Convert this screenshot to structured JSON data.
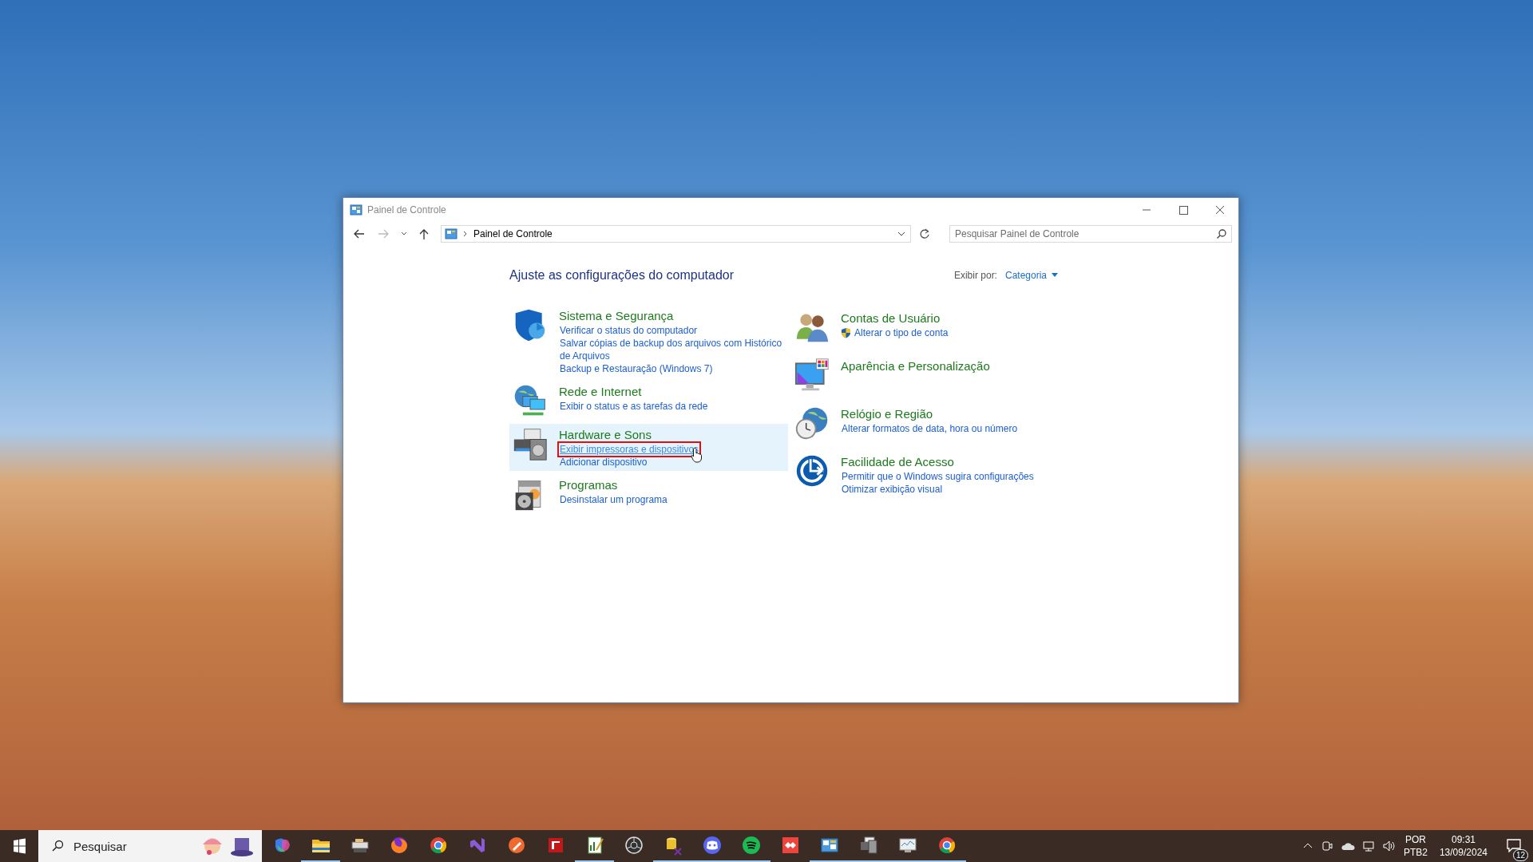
{
  "window": {
    "title": "Painel de Controle"
  },
  "address_bar": {
    "back": {
      "disabled": false
    },
    "forward": {
      "disabled": true
    },
    "path": "Painel de Controle",
    "search": {
      "placeholder": "Pesquisar Painel de Controle"
    }
  },
  "heading": "Ajuste as configurações do computador",
  "view_by": {
    "label": "Exibir por:",
    "value": "Categoria"
  },
  "categories_left": [
    {
      "kind": "shield",
      "title": "Sistema e Segurança",
      "highlighted": false,
      "links": [
        {
          "text": "Verificar o status do computador",
          "hovered": false,
          "marked": false,
          "shield": false
        },
        {
          "text": "Salvar cópias de backup dos arquivos com Histórico de Arquivos",
          "hovered": false,
          "marked": false,
          "shield": false
        },
        {
          "text": "Backup e Restauração (Windows 7)",
          "hovered": false,
          "marked": false,
          "shield": false
        }
      ]
    },
    {
      "kind": "network",
      "title": "Rede e Internet",
      "highlighted": false,
      "links": [
        {
          "text": "Exibir o status e as tarefas da rede",
          "hovered": false,
          "marked": false,
          "shield": false
        }
      ]
    },
    {
      "kind": "printer",
      "title": "Hardware e Sons",
      "highlighted": true,
      "links": [
        {
          "text": "Exibir impressoras e dispositivos",
          "hovered": true,
          "marked": true,
          "shield": false
        },
        {
          "text": "Adicionar dispositivo",
          "hovered": false,
          "marked": false,
          "shield": false
        }
      ]
    },
    {
      "kind": "programs",
      "title": "Programas",
      "highlighted": false,
      "links": [
        {
          "text": "Desinstalar um programa",
          "hovered": false,
          "marked": false,
          "shield": false
        }
      ]
    }
  ],
  "categories_right": [
    {
      "kind": "users",
      "title": "Contas de Usuário",
      "highlighted": false,
      "links": [
        {
          "text": "Alterar o tipo de conta",
          "hovered": false,
          "marked": false,
          "shield": true
        }
      ]
    },
    {
      "kind": "monitor",
      "title": "Aparência e Personalização",
      "highlighted": false
    },
    {
      "kind": "clock",
      "title": "Relógio e Região",
      "highlighted": false,
      "links": [
        {
          "text": "Alterar formatos de data, hora ou número",
          "hovered": false,
          "marked": false,
          "shield": false
        }
      ]
    },
    {
      "kind": "access",
      "title": "Facilidade de Acesso",
      "highlighted": false,
      "links": [
        {
          "text": "Permitir que o Windows sugira configurações",
          "hovered": false,
          "marked": false,
          "shield": false
        },
        {
          "text": "Otimizar exibição visual",
          "hovered": false,
          "marked": false,
          "shield": false
        }
      ]
    }
  ],
  "taskbar": {
    "search": {
      "placeholder": "Pesquisar"
    },
    "apps": [
      {
        "kind": "swirl",
        "running": false
      },
      {
        "kind": "folder",
        "running": true
      },
      {
        "kind": "scanner",
        "running": false
      },
      {
        "kind": "foxglobe",
        "running": false
      },
      {
        "kind": "ring",
        "running": false
      },
      {
        "kind": "ribbon",
        "running": false
      },
      {
        "kind": "pen",
        "running": false
      },
      {
        "kind": "redsquare",
        "running": false
      },
      {
        "kind": "chart",
        "running": true
      },
      {
        "kind": "aperture",
        "running": false
      },
      {
        "kind": "cylinder",
        "running": true
      },
      {
        "kind": "chat",
        "running": true
      },
      {
        "kind": "waves",
        "running": true
      },
      {
        "kind": "diamond",
        "running": false
      },
      {
        "kind": "panel",
        "running": true
      },
      {
        "kind": "printer",
        "running": true
      },
      {
        "kind": "monitor",
        "running": true
      },
      {
        "kind": "ring",
        "running": true
      }
    ],
    "tray": {
      "language": "POR",
      "layout": "PTB2",
      "time": "09:31",
      "date": "13/09/2024",
      "notifications": "12"
    }
  }
}
